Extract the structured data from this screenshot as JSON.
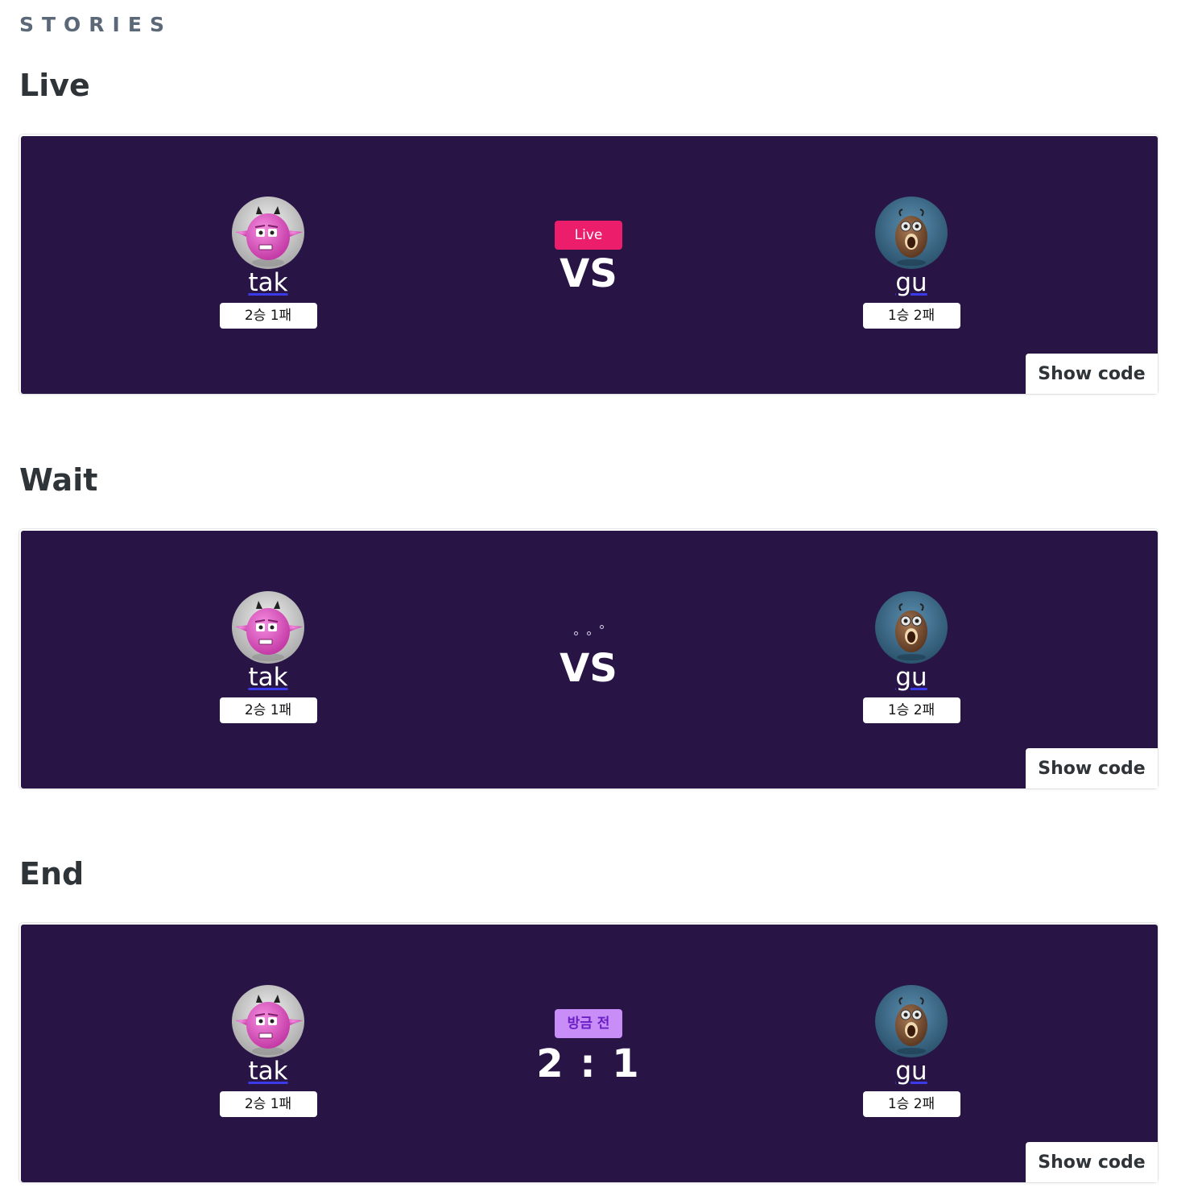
{
  "header": {
    "label": "STORIES"
  },
  "stories": [
    {
      "title": "Live",
      "left_player": {
        "name": "tak",
        "record": "2승 1패"
      },
      "right_player": {
        "name": "gu",
        "record": "1승 2패"
      },
      "status_badge": "Live",
      "center_text": "VS",
      "show_code_label": "Show code"
    },
    {
      "title": "Wait",
      "left_player": {
        "name": "tak",
        "record": "2승 1패"
      },
      "right_player": {
        "name": "gu",
        "record": "1승 2패"
      },
      "status_indicator": "loading-dots-icon",
      "center_text": "VS",
      "show_code_label": "Show code"
    },
    {
      "title": "End",
      "left_player": {
        "name": "tak",
        "record": "2승 1패"
      },
      "right_player": {
        "name": "gu",
        "record": "1승 2패"
      },
      "status_badge": "방금 전",
      "center_text": "2 : 1",
      "show_code_label": "Show code"
    }
  ],
  "colors": {
    "canvas_bg": "#281546",
    "live_badge": "#ec1d6a",
    "ended_badge_bg": "#c88df7",
    "ended_badge_text": "#6a1fc4",
    "heading": "#2e3438",
    "stories_label": "#5a6878"
  },
  "icons": {
    "left_avatar": "pink-devil-avatar-icon",
    "right_avatar": "brown-bug-avatar-icon"
  }
}
